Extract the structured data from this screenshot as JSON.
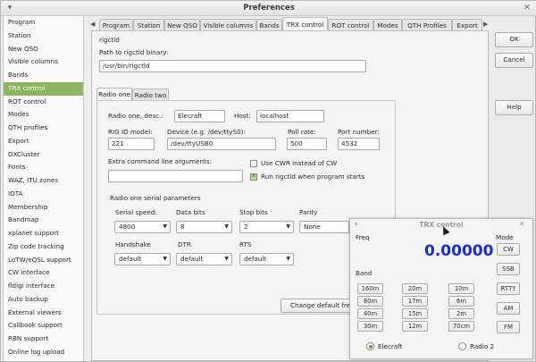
{
  "window": {
    "title": "Preferences"
  },
  "sidebar": {
    "items": [
      {
        "label": "Program"
      },
      {
        "label": "Station"
      },
      {
        "label": "New QSO"
      },
      {
        "label": "Visible columns"
      },
      {
        "label": "Bands"
      },
      {
        "label": "TRX control",
        "active": true
      },
      {
        "label": "ROT control"
      },
      {
        "label": "Modes"
      },
      {
        "label": "QTH profiles"
      },
      {
        "label": "Export"
      },
      {
        "label": "DXCluster"
      },
      {
        "label": "Fonts"
      },
      {
        "label": "WAZ, ITU zones"
      },
      {
        "label": "IOTA"
      },
      {
        "label": "Membership"
      },
      {
        "label": "Bandmap"
      },
      {
        "label": "xplanet support"
      },
      {
        "label": "Zip code tracking"
      },
      {
        "label": "LoTW/eQSL support"
      },
      {
        "label": "CW interface"
      },
      {
        "label": "fldigi interface"
      },
      {
        "label": "Auto backup"
      },
      {
        "label": "External viewers"
      },
      {
        "label": "Callbook support"
      },
      {
        "label": "RBN support"
      },
      {
        "label": "Online log upload"
      }
    ]
  },
  "tabs": {
    "items": [
      {
        "label": "Program"
      },
      {
        "label": "Station"
      },
      {
        "label": "New QSO"
      },
      {
        "label": "Visible columns"
      },
      {
        "label": "Bands"
      },
      {
        "label": "TRX control",
        "active": true
      },
      {
        "label": "ROT control"
      },
      {
        "label": "Modes"
      },
      {
        "label": "QTH Profiles"
      },
      {
        "label": "Export"
      }
    ]
  },
  "rigctld": {
    "group_label": "rigctld",
    "path_label": "Path to rigctld binary:",
    "path_value": "/usr/bin/rigctld"
  },
  "radio_tabs": [
    {
      "label": "Radio one"
    },
    {
      "label": "Radio two"
    }
  ],
  "radio_one": {
    "desc_label": "Radio one, desc.:",
    "desc_value": "Elecraft",
    "host_label": "Host:",
    "host_value": "localhost",
    "rig_id_label": "RIG ID model:",
    "rig_id_value": "221",
    "device_label": "Device (e.g. /dev/ttyS0):",
    "device_value": "/dev/ttyUSB0",
    "poll_label": "Poll rate:",
    "poll_value": "500",
    "port_label": "Port number:",
    "port_value": "4532",
    "extra_label": "Extra command line arguments:",
    "extra_value": "",
    "use_cwr_label": "Use CWR instead of CW",
    "use_cwr_checked": false,
    "run_rigctld_label": "Run rigctld when program starts",
    "run_rigctld_checked": true,
    "serial_params_label": "Radio one serial parameters",
    "serial_speed_label": "Serial speed:",
    "serial_speed_value": "4800",
    "data_bits_label": "Data bits",
    "data_bits_value": "8",
    "stop_bits_label": "Stop bits",
    "stop_bits_value": "2",
    "parity_label": "Parity",
    "parity_value": "None",
    "handshake_label": "Handshake",
    "handshake_value": "default",
    "dtr_label": "DTR",
    "dtr_value": "default",
    "rts_label": "RTS",
    "rts_value": "default",
    "change_default_label": "Change default freq"
  },
  "buttons": {
    "ok": "OK",
    "cancel": "Cancel",
    "help": "Help"
  },
  "trx_widget": {
    "title": "TRX control",
    "freq_label": "Freq",
    "freq_value": "0.00000",
    "mode_label": "Mode",
    "band_label": "Band",
    "bands": [
      "160m",
      "20m",
      "10m",
      "80m",
      "17m",
      "6m",
      "40m",
      "15m",
      "2m",
      "30m",
      "12m",
      "70cm"
    ],
    "modes": [
      "CW",
      "SSB",
      "RTTY",
      "AM",
      "FM"
    ],
    "radio1_label": "Elecraft",
    "radio2_label": "Radio 2",
    "selected_radio": "Elecraft"
  },
  "colors": {
    "accent": "#8cb562",
    "freq": "#1a2bd6"
  }
}
